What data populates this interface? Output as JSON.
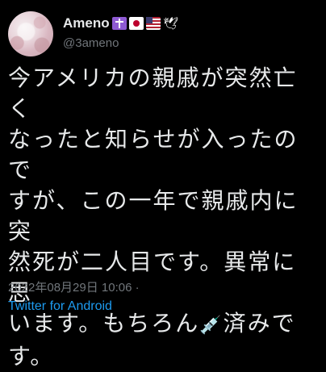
{
  "author": {
    "display_name": "Ameno",
    "handle": "@3ameno",
    "emojis": [
      "latin-cross-emoji",
      "japan-flag-emoji",
      "us-flag-emoji",
      "dove-emoji"
    ]
  },
  "tweet": {
    "lines": [
      "今アメリカの親戚が突然亡く",
      "なったと知らせが入ったので",
      "すが、この一年で親戚内に突",
      "然死が二人目です。異常に思",
      "います。もちろん",
      "済みで",
      "す。"
    ],
    "inline_emoji": "syringe-emoji"
  },
  "meta": {
    "timestamp": "2022年08月29日 10:06 ·",
    "source": "Twitter for Android"
  },
  "colors": {
    "background": "#000000",
    "text": "#e7e9ea",
    "secondary": "#71767b",
    "link": "#1d9bf0"
  }
}
